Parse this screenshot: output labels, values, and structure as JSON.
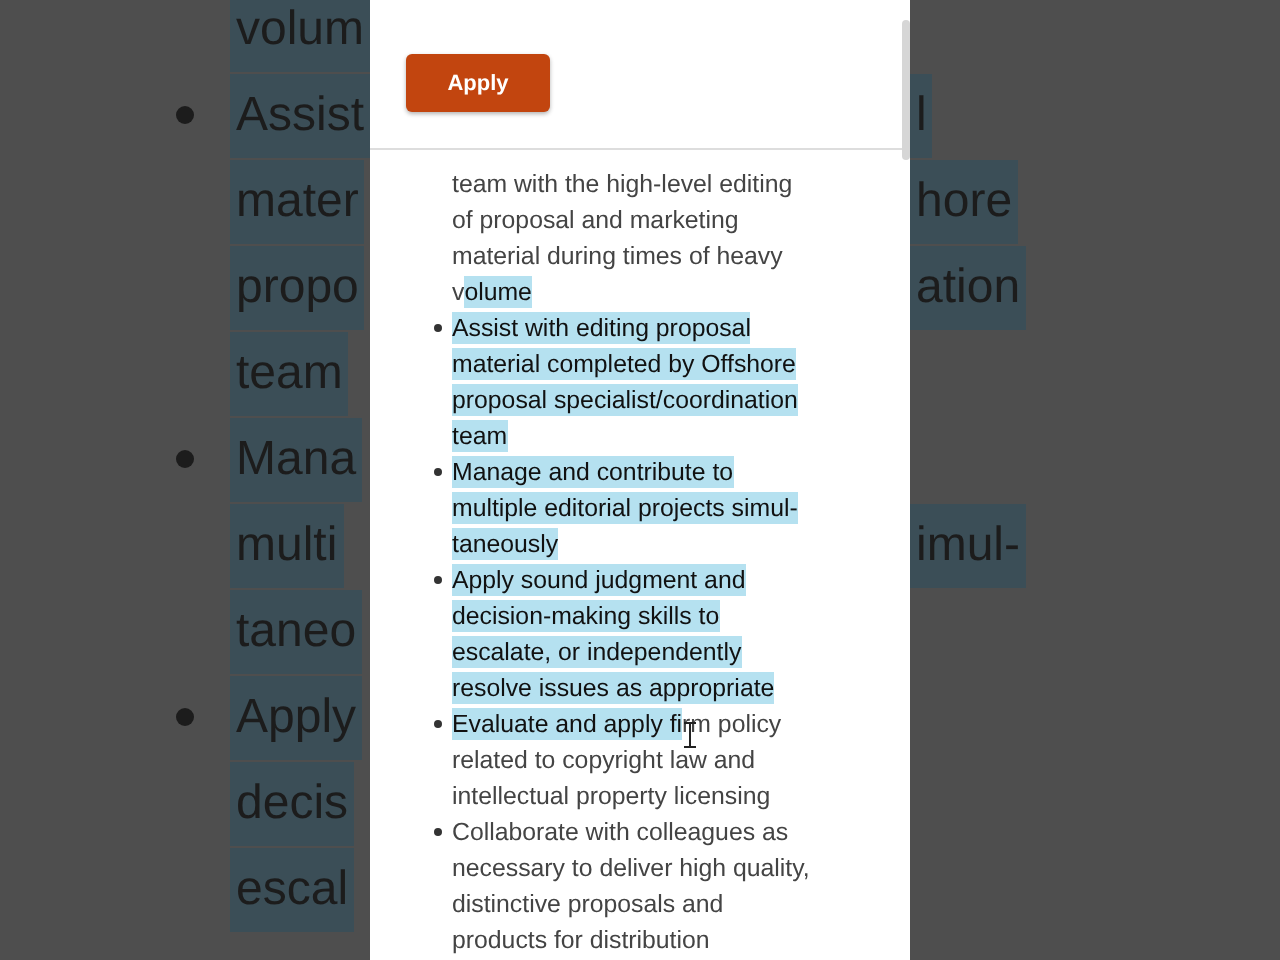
{
  "backdrop": {
    "rows": [
      {
        "bullet": false,
        "left": "volum",
        "highlighted": true
      },
      {
        "bullet": true,
        "left": "Assist",
        "right": "l",
        "highlighted": true
      },
      {
        "bullet": false,
        "left": "mater",
        "right": "hore",
        "highlighted": true
      },
      {
        "bullet": false,
        "left": "propo",
        "right": "ation",
        "highlighted": true
      },
      {
        "bullet": false,
        "left": "team",
        "highlighted": true
      },
      {
        "bullet": true,
        "left": "Mana",
        "highlighted": true
      },
      {
        "bullet": false,
        "left": "multi",
        "right": "imul-",
        "highlighted": true
      },
      {
        "bullet": false,
        "left": "taneo",
        "highlighted": true
      },
      {
        "bullet": true,
        "left": "Apply",
        "highlighted": true
      },
      {
        "bullet": false,
        "left": "decis",
        "highlighted": true
      },
      {
        "bullet": false,
        "left": "escal",
        "highlighted": true
      }
    ]
  },
  "phone": {
    "apply_button": "Apply",
    "items": [
      {
        "continued": true,
        "segments": [
          {
            "text": "team with the high-level editing\nof proposal and marketing\nmaterial during times of heavy\nv",
            "selected": false
          },
          {
            "text": "olume",
            "selected": true
          }
        ]
      },
      {
        "continued": false,
        "segments": [
          {
            "text": "Assist with editing proposal\nmaterial completed by Offshore\nproposal specialist/coordination\nteam",
            "selected": true
          }
        ]
      },
      {
        "continued": false,
        "segments": [
          {
            "text": "Manage and contribute to\nmultiple editorial projects simul-\ntaneously",
            "selected": true
          }
        ]
      },
      {
        "continued": false,
        "segments": [
          {
            "text": "Apply sound judgment and\ndecision-making skills to\nescalate, or independently\nresolve issues as appropriate",
            "selected": true
          }
        ]
      },
      {
        "continued": false,
        "segments": [
          {
            "text": "Evaluate and apply fi",
            "selected": true
          },
          {
            "text": "rm policy\nrelated to copyright law and\nintellectual property licensing",
            "selected": false
          }
        ]
      },
      {
        "continued": false,
        "segments": [
          {
            "text": "Collaborate with colleagues as\nnecessary to deliver high quality,\ndistinctive proposals and\nproducts for distribution",
            "selected": false
          }
        ]
      }
    ]
  }
}
